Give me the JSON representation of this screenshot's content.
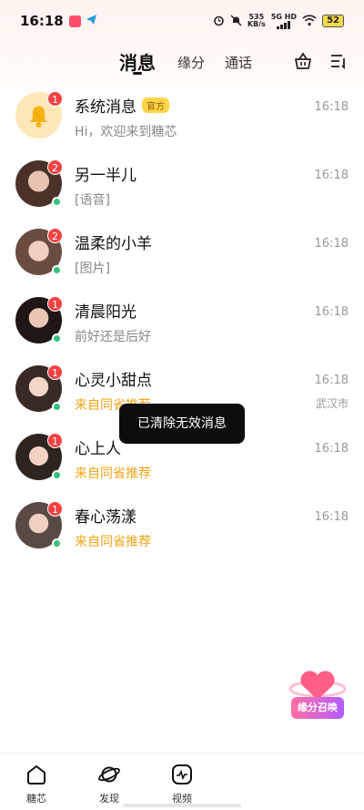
{
  "status_bar": {
    "time": "16:18",
    "net_speed_value": "535",
    "net_speed_unit": "KB/s",
    "net_type": "5G HD",
    "battery": "52"
  },
  "tabs": [
    {
      "label": "消息",
      "active": true
    },
    {
      "label": "缘分",
      "active": false
    },
    {
      "label": "通话",
      "active": false
    }
  ],
  "top_icons": [
    "basket-icon",
    "sort-list-icon"
  ],
  "conversations": [
    {
      "name": "系统消息",
      "tag": "官方",
      "preview": "Hi，欢迎来到糖芯",
      "time": "16:18",
      "badge": "1",
      "online": false,
      "highlight": false
    },
    {
      "name": "另一半儿",
      "preview": "[语音]",
      "time": "16:18",
      "badge": "2",
      "online": true,
      "highlight": false
    },
    {
      "name": "温柔的小羊",
      "preview": "[图片]",
      "time": "16:18",
      "badge": "2",
      "online": true,
      "highlight": false
    },
    {
      "name": "清晨阳光",
      "preview": "前好还是后好",
      "time": "16:18",
      "badge": "1",
      "online": true,
      "highlight": false
    },
    {
      "name": "心灵小甜点",
      "preview": "来自同省推荐",
      "time": "16:18",
      "location": "武汉市",
      "badge": "1",
      "online": true,
      "highlight": true
    },
    {
      "name": "心上人",
      "preview": "来自同省推荐",
      "time": "16:18",
      "badge": "1",
      "online": true,
      "highlight": true
    },
    {
      "name": "春心荡漾",
      "preview": "来自同省推荐",
      "time": "16:18",
      "badge": "1",
      "online": true,
      "highlight": true
    }
  ],
  "toast": "已清除无效消息",
  "float_button": {
    "label": "缘分召唤"
  },
  "bottom_nav": [
    {
      "label": "糖芯",
      "icon": "home-icon"
    },
    {
      "label": "发现",
      "icon": "planet-icon"
    },
    {
      "label": "视频",
      "icon": "video-icon"
    }
  ],
  "colors": {
    "badge": "#f24141",
    "online": "#33c27a",
    "highlight_text": "#f0a416",
    "official_tag": "#ffd54a",
    "toast_bg": "#0d0d0d"
  }
}
